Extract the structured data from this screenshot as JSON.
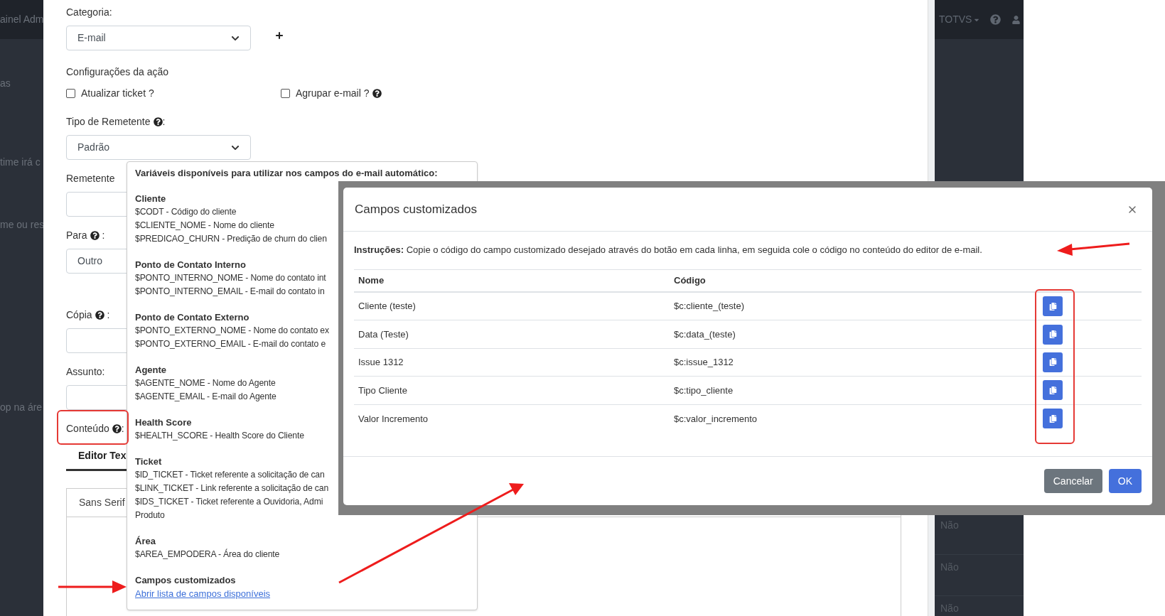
{
  "left_strip": {
    "header_text": "ainel Adm",
    "texts": [
      "as",
      "time irá c",
      "me ou res",
      "op na áre"
    ]
  },
  "right_strip": {
    "account": "TOTVS",
    "rows": [
      "Não",
      "Não",
      "Não"
    ]
  },
  "form": {
    "category": {
      "label": "Categoria:",
      "value": "E-mail"
    },
    "actions": {
      "title": "Configurações da ação",
      "options": [
        {
          "label": "Atualizar ticket ?",
          "checked": false
        },
        {
          "label": "Agrupar e-mail ?",
          "checked": false,
          "help": true
        }
      ]
    },
    "sender_type": {
      "label": "Tipo de Remetente",
      "help": true,
      "suffix": ":",
      "value": "Padrão"
    },
    "recipient_fields": [
      {
        "kind": "input",
        "label": "Remetente"
      },
      {
        "kind": "select",
        "label": "Para",
        "help": true,
        "suffix": " :",
        "value": "Outro"
      }
    ],
    "message_fields": [
      {
        "kind": "input",
        "label": "Cópia",
        "help": true,
        "suffix": " :"
      },
      {
        "kind": "input",
        "label": "Assunto:"
      }
    ],
    "content": {
      "label": "Conteúdo",
      "help": true,
      "suffix": ":",
      "tabs": [
        {
          "label": "Editor Tex",
          "selected": true
        }
      ],
      "font": "Sans Serif"
    }
  },
  "variables_popover": {
    "title": "Variáveis disponíveis para utilizar nos campos do e-mail automático:",
    "sections": [
      {
        "heading": "Cliente",
        "lines": [
          "$CODT - Código do cliente",
          "$CLIENTE_NOME - Nome do cliente",
          "$PREDICAO_CHURN - Predição de churn do clien"
        ]
      },
      {
        "heading": "Ponto de Contato Interno",
        "lines": [
          "$PONTO_INTERNO_NOME - Nome do contato int",
          "$PONTO_INTERNO_EMAIL - E-mail do contato in"
        ]
      },
      {
        "heading": "Ponto de Contato Externo",
        "lines": [
          "$PONTO_EXTERNO_NOME - Nome do contato ex",
          "$PONTO_EXTERNO_EMAIL - E-mail do contato e"
        ]
      },
      {
        "heading": "Agente",
        "lines": [
          "$AGENTE_NOME - Nome do Agente",
          "$AGENTE_EMAIL - E-mail do Agente"
        ]
      },
      {
        "heading": "Health Score",
        "lines": [
          "$HEALTH_SCORE - Health Score do Cliente"
        ]
      },
      {
        "heading": "Ticket",
        "lines": [
          "$ID_TICKET - Ticket referente a solicitação de can",
          "$LINK_TICKET - Link referente a solicitação de can",
          "$IDS_TICKET - Ticket referente a Ouvidoria, Admi",
          "Produto"
        ]
      },
      {
        "heading": "Área",
        "lines": [
          "$AREA_EMPODERA - Área do cliente"
        ]
      },
      {
        "heading": "Campos customizados",
        "link": "Abrir lista de campos disponíveis"
      }
    ]
  },
  "modal": {
    "title": "Campos customizados",
    "instructions": "**Instruções:** Copie o código do campo customizado desejado através do botão em cada linha, em seguida cole o código no conteúdo do editor de e-mail.",
    "columns": [
      "Nome",
      "Código"
    ],
    "rows": [
      {
        "name": "Cliente (teste)",
        "code": "$c:cliente_(teste)"
      },
      {
        "name": "Data (Teste)",
        "code": "$c:data_(teste)"
      },
      {
        "name": "Issue 1312",
        "code": "$c:issue_1312"
      },
      {
        "name": "Tipo Cliente",
        "code": "$c:tipo_cliente"
      },
      {
        "name": "Valor Incremento",
        "code": "$c:valor_incremento"
      }
    ],
    "buttons": [
      {
        "label": "Cancelar",
        "kind": "secondary"
      },
      {
        "label": "OK",
        "kind": "primary"
      }
    ]
  }
}
